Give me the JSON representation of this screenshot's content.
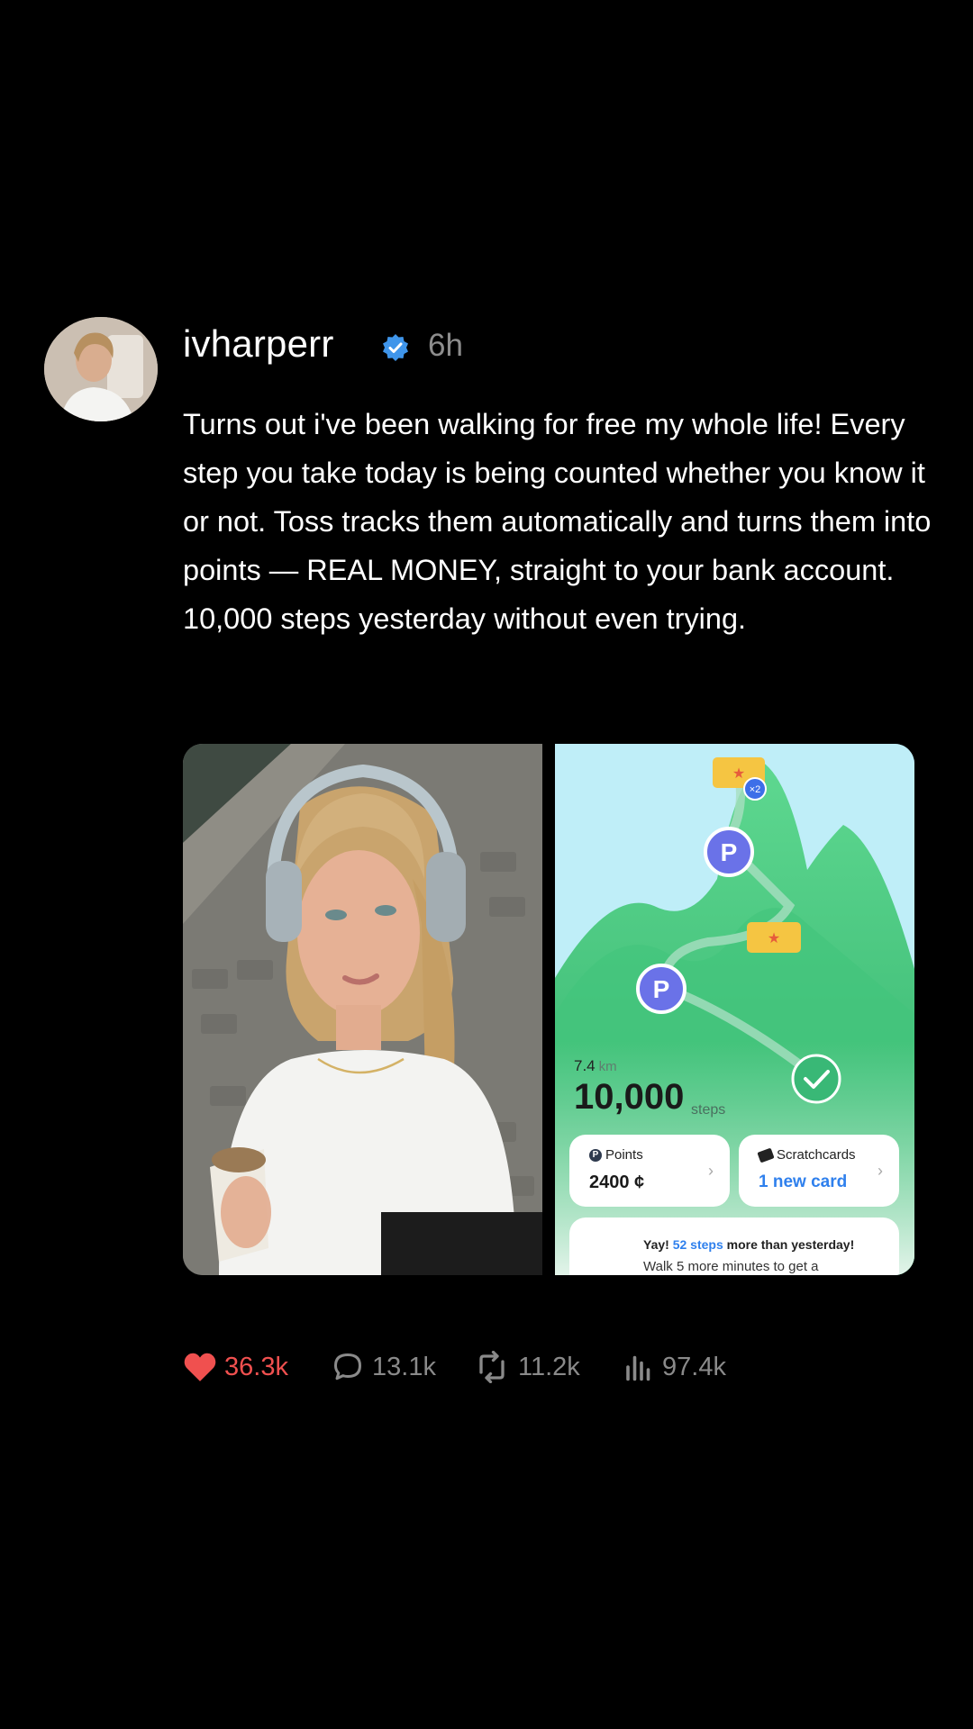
{
  "post": {
    "username": "ivharperr",
    "time": "6h",
    "text": "Turns out i've been walking for free my whole life! Every step you take today is being counted whether you know it or not. Toss tracks them automatically and turns them into points — REAL MONEY, straight to your bank account. 10,000 steps yesterday without even trying.",
    "verified_icon": "verified-badge-icon",
    "avatar_icon": "profile-avatar",
    "accent_color": "#f0504f",
    "verified_color": "#3f95ea"
  },
  "app_screenshot": {
    "distance_value": "7.4",
    "distance_unit": "km",
    "steps_value": "10,000",
    "steps_unit": "steps",
    "points_label": "Points",
    "points_value": "2400 ¢",
    "scratch_label": "Scratchcards",
    "scratch_value": "1 new card",
    "ticket_multiplier": "×2",
    "marker_letter": "P",
    "yay_prefix": "Yay!",
    "yay_highlight": "52 steps",
    "yay_suffix": "more than yesterday!",
    "walk_text": "Walk 5 more minutes to get a"
  },
  "actions": {
    "likes": "36.3k",
    "replies": "13.1k",
    "reposts": "11.2k",
    "views": "97.4k"
  }
}
